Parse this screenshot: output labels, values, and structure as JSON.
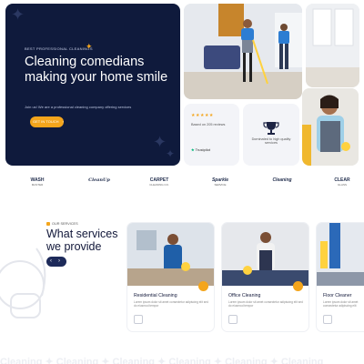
{
  "hero": {
    "eyebrow": "BEST PROFESSIONAL CLEANINGS",
    "title": "Cleaning comedians making your home smile",
    "subtitle": "Join us! We are a professional cleaning company offering services",
    "cta_label": "GET IN TOUCH",
    "cta_arrow": "›"
  },
  "rating_card": {
    "stars": "★★★★★",
    "text": "Based on 205 reviews",
    "trustpilot": "Trustpilot"
  },
  "award_card": {
    "text": "Dominated to high quality services"
  },
  "logos": [
    {
      "title": "WASH",
      "sub": "MASTER"
    },
    {
      "title": "CleanUp",
      "sub": ""
    },
    {
      "title": "CARPET",
      "sub": "CLEANING CO."
    },
    {
      "title": "Sparkle",
      "sub": "SERVICE"
    },
    {
      "title": "Cleaning",
      "sub": ""
    },
    {
      "title": "CLEAR",
      "sub": "GLASS"
    }
  ],
  "services": {
    "eyebrow": "OUR SERVICES",
    "title": "What services we provide",
    "prev": "‹",
    "next": "›",
    "items": [
      {
        "name": "Residential Cleaning",
        "desc": "Lorem ipsum dolor sit amet consectetur adipiscing elit sed do eiusmod tempor"
      },
      {
        "name": "Office Cleaning",
        "desc": "Lorem ipsum dolor sit amet consectetur adipiscing elit sed do eiusmod tempor"
      },
      {
        "name": "Floor Cleaner",
        "desc": "Lorem ipsum dolor sit amet consectetur adipiscing elit"
      }
    ]
  },
  "marquee": "Cleaning ✦ Cleaning ✦ Cleaning ✦ Cleaning ✦ Cleaning ✦ Cleaning",
  "colors": {
    "navy": "#0f1a3c",
    "accent": "#f4a51c"
  }
}
